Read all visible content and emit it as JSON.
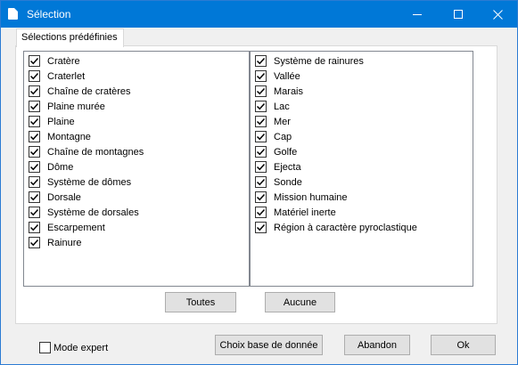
{
  "window": {
    "title": "Sélection",
    "controls": {
      "minimize": "minimize",
      "maximize": "maximize",
      "close": "close"
    }
  },
  "tab": {
    "label": "Sélections prédéfinies"
  },
  "left_items": [
    {
      "label": "Cratère",
      "checked": true
    },
    {
      "label": "Craterlet",
      "checked": true
    },
    {
      "label": "Chaîne de cratères",
      "checked": true
    },
    {
      "label": "Plaine murée",
      "checked": true
    },
    {
      "label": "Plaine",
      "checked": true
    },
    {
      "label": "Montagne",
      "checked": true
    },
    {
      "label": "Chaîne de montagnes",
      "checked": true
    },
    {
      "label": "Dôme",
      "checked": true
    },
    {
      "label": "Système de dômes",
      "checked": true
    },
    {
      "label": "Dorsale",
      "checked": true
    },
    {
      "label": "Système de dorsales",
      "checked": true
    },
    {
      "label": "Escarpement",
      "checked": true
    },
    {
      "label": "Rainure",
      "checked": true
    }
  ],
  "right_items": [
    {
      "label": "Système de rainures",
      "checked": true
    },
    {
      "label": "Vallée",
      "checked": true
    },
    {
      "label": "Marais",
      "checked": true
    },
    {
      "label": "Lac",
      "checked": true
    },
    {
      "label": "Mer",
      "checked": true
    },
    {
      "label": "Cap",
      "checked": true
    },
    {
      "label": "Golfe",
      "checked": true
    },
    {
      "label": "Ejecta",
      "checked": true
    },
    {
      "label": "Sonde",
      "checked": true
    },
    {
      "label": "Mission humaine",
      "checked": true
    },
    {
      "label": "Matériel inerte",
      "checked": true
    },
    {
      "label": "Région à caractère pyroclastique",
      "checked": true
    }
  ],
  "buttons": {
    "all": "Toutes",
    "none": "Aucune",
    "db": "Choix base de donnée",
    "cancel": "Abandon",
    "ok": "Ok"
  },
  "expert": {
    "label": "Mode expert",
    "checked": false
  },
  "colors": {
    "titlebar": "#0078d7",
    "panel": "#ffffff",
    "button": "#e1e1e1"
  }
}
